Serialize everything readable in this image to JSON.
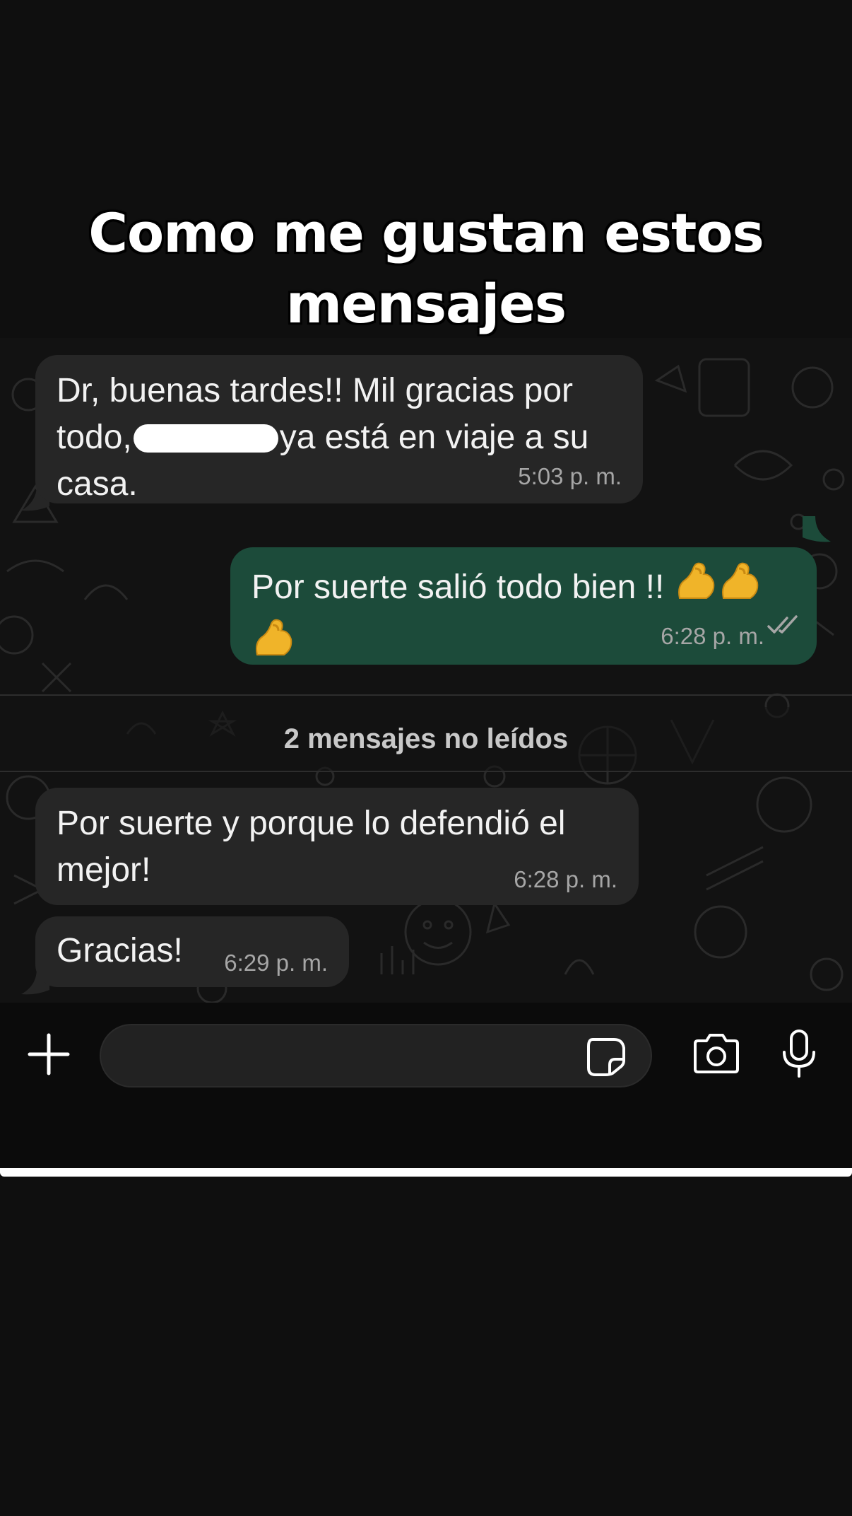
{
  "caption": {
    "line1": "Como me gustan estos",
    "line2": "mensajes"
  },
  "messages": [
    {
      "direction": "incoming",
      "text_line1": "Dr, buenas tardes!! Mil gracias por",
      "text_line2_a": "todo,",
      "text_line2_b": "ya está en viaje a su",
      "text_line3": "casa.",
      "time": "5:03 p. m.",
      "redacted_name": true
    },
    {
      "direction": "outgoing",
      "text": "Por suerte salió todo bien !!",
      "emoji": "flexed-biceps",
      "emoji_count": 3,
      "time": "6:28 p. m.",
      "status": "read-double-check"
    },
    {
      "direction": "incoming",
      "text_line1": "Por suerte y porque lo defendió  el",
      "text_line2": "mejor!",
      "time": "6:28 p. m."
    },
    {
      "direction": "incoming",
      "text": "Gracias!",
      "time": "6:29 p. m."
    }
  ],
  "unread_divider": "2 mensajes no leídos",
  "composer": {
    "placeholder": "",
    "icons": [
      "plus-icon",
      "sticker-icon",
      "camera-icon",
      "microphone-icon"
    ]
  },
  "colors": {
    "incoming_bubble": "#262626",
    "outgoing_bubble": "#1c4b3a",
    "background": "#0f0f0f"
  }
}
